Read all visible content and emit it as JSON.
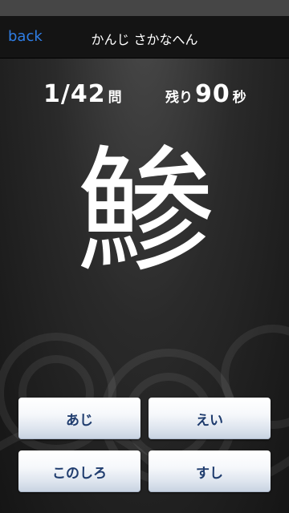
{
  "nav": {
    "back_label": "back",
    "title": "かんじ さかなへん"
  },
  "quiz": {
    "current": "1",
    "separator": "/",
    "total": "42",
    "question_unit": "問",
    "time_prefix": "残り",
    "time_left": "90",
    "time_unit": "秒",
    "kanji": "鯵"
  },
  "answers": [
    "あじ",
    "えい",
    "このしろ",
    "すし"
  ]
}
